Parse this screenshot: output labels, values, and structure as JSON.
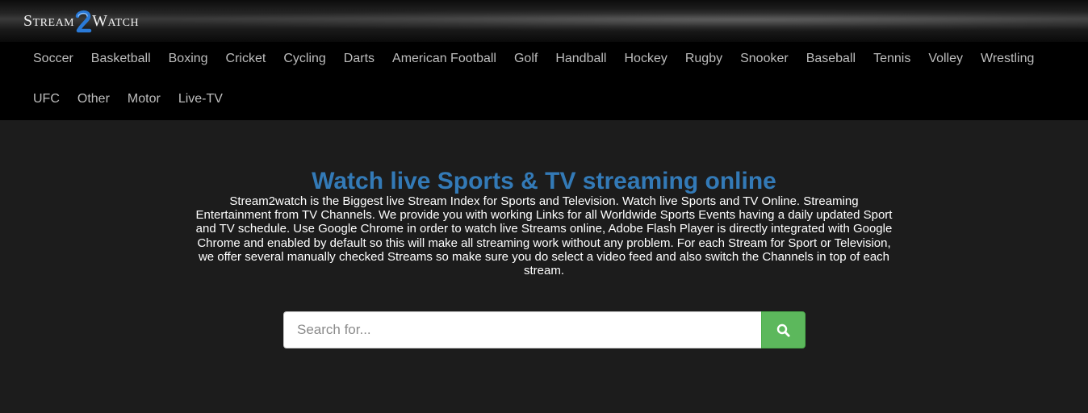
{
  "logo": {
    "word1": "Stream",
    "digit": "2",
    "word2": "Watch"
  },
  "nav": {
    "row1": [
      "Soccer",
      "Basketball",
      "Boxing",
      "Cricket",
      "Cycling",
      "Darts",
      "American Football",
      "Golf",
      "Handball",
      "Hockey",
      "Rugby",
      "Snooker",
      "Baseball",
      "Tennis",
      "Volley",
      "Wrestling"
    ],
    "row2": [
      "UFC",
      "Other",
      "Motor",
      "Live-TV"
    ]
  },
  "hero": {
    "title": "Watch live Sports & TV streaming online",
    "description": "Stream2watch is the Biggest live Stream Index for Sports and Television. Watch live Sports and TV Online. Streaming Entertainment from TV Channels. We provide you with working Links for all Worldwide Sports Events having a daily updated Sport and TV schedule. Use Google Chrome in order to watch live Streams online, Adobe Flash Player is directly integrated with Google Chrome and enabled by default so this will make all streaming work without any problem. For each Stream for Sport or Television, we offer several manually checked Streams so make sure you do select a video feed and also switch the Channels in top of each stream."
  },
  "search": {
    "placeholder": "Search for...",
    "value": "",
    "button_icon": "search-icon"
  },
  "colors": {
    "title": "#337ab7",
    "search_button": "#5cb85c",
    "nav_text": "#bdbdbd",
    "background": "#1c1c1c"
  }
}
